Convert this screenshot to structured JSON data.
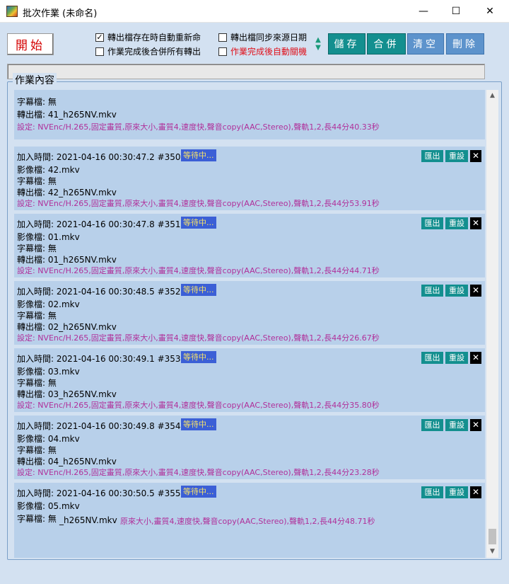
{
  "window": {
    "title": "批次作業 (未命名)",
    "minimize": "—",
    "maximize": "☐",
    "close": "✕"
  },
  "toolbar": {
    "start_label": "開始",
    "options": [
      {
        "label": "轉出檔存在時自動重新命",
        "checked": true
      },
      {
        "label": "作業完成後合併所有轉出",
        "checked": false
      },
      {
        "label": "轉出檔同步來源日期",
        "checked": false
      },
      {
        "label": "作業完成後自動關機",
        "checked": false
      }
    ],
    "save_label": "儲存",
    "merge_label": "合併",
    "clear_label": "清空",
    "delete_label": "刪除"
  },
  "progress": {
    "value": 0
  },
  "job_list": {
    "group_title": "作業內容",
    "partial_top": {
      "subtitle_line": "字幕檔: 無",
      "output_line": "轉出檔: 41_h265NV.mkv",
      "settings_line": "設定: NVEnc/H.265,固定畫質,原來大小,畫質4,速度快,聲音copy(AAC,Stereo),聲軌1,2,長44分40.33秒"
    },
    "items": [
      {
        "time_line": "加入時間: 2021-04-16 00:30:47.2  #350",
        "status": "等待中...",
        "video_line": "影像檔: 42.mkv",
        "subtitle_line": "字幕檔: 無",
        "output_line": "轉出檔: 42_h265NV.mkv",
        "settings_line": "設定: NVEnc/H.265,固定畫質,原來大小,畫質4,速度快,聲音copy(AAC,Stereo),聲軌1,2,長44分53.91秒"
      },
      {
        "time_line": "加入時間: 2021-04-16 00:30:47.8  #351",
        "status": "等待中...",
        "video_line": "影像檔: 01.mkv",
        "subtitle_line": "字幕檔: 無",
        "output_line": "轉出檔: 01_h265NV.mkv",
        "settings_line": "設定: NVEnc/H.265,固定畫質,原來大小,畫質4,速度快,聲音copy(AAC,Stereo),聲軌1,2,長44分44.71秒"
      },
      {
        "time_line": "加入時間: 2021-04-16 00:30:48.5  #352",
        "status": "等待中...",
        "video_line": "影像檔: 02.mkv",
        "subtitle_line": "字幕檔: 無",
        "output_line": "轉出檔: 02_h265NV.mkv",
        "settings_line": "設定: NVEnc/H.265,固定畫質,原來大小,畫質4,速度快,聲音copy(AAC,Stereo),聲軌1,2,長44分26.67秒"
      },
      {
        "time_line": "加入時間: 2021-04-16 00:30:49.1  #353",
        "status": "等待中...",
        "video_line": "影像檔: 03.mkv",
        "subtitle_line": "字幕檔: 無",
        "output_line": "轉出檔: 03_h265NV.mkv",
        "settings_line": "設定: NVEnc/H.265,固定畫質,原來大小,畫質4,速度快,聲音copy(AAC,Stereo),聲軌1,2,長44分35.80秒"
      },
      {
        "time_line": "加入時間: 2021-04-16 00:30:49.8  #354",
        "status": "等待中...",
        "video_line": "影像檔: 04.mkv",
        "subtitle_line": "字幕檔: 無",
        "output_line": "轉出檔: 04_h265NV.mkv",
        "settings_line": "設定: NVEnc/H.265,固定畫質,原來大小,畫質4,速度快,聲音copy(AAC,Stereo),聲軌1,2,長44分23.28秒"
      },
      {
        "time_line": "加入時間: 2021-04-16 00:30:50.5  #355",
        "status": "等待中...",
        "video_line": "影像檔: 05.mkv",
        "subtitle_line": "字幕檔: 無",
        "output_line": "_h265NV.mkv",
        "settings_line": "原來大小,畫質4,速度快,聲音copy(AAC,Stereo),聲軌1,2,長44分48.71秒"
      }
    ],
    "export_label": "匯出",
    "reset_label": "重設",
    "remove_label": "✕"
  },
  "scrollbar": {
    "up": "▲",
    "down": "▼"
  }
}
